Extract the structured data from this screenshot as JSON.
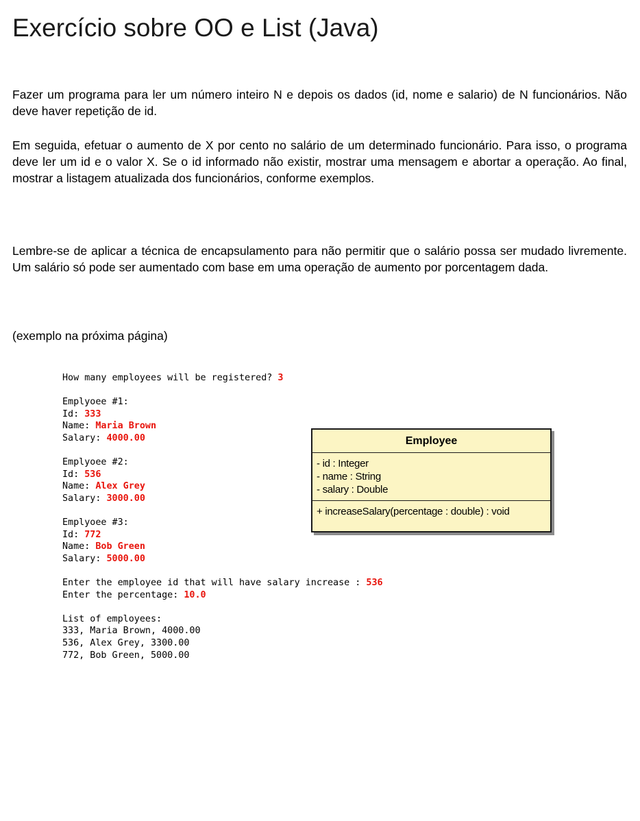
{
  "title": "Exercício sobre OO e List (Java)",
  "paragraphs": {
    "p1": "Fazer um programa para ler um número inteiro N e depois os dados (id, nome e salario) de N funcionários. Não deve haver repetição de id.",
    "p2": "Em seguida, efetuar o aumento de X por cento no salário de um determinado funcionário. Para isso, o programa deve ler um id e o valor X. Se o id informado não existir, mostrar uma mensagem e abortar a operação. Ao final, mostrar a listagem atualizada dos funcionários, conforme exemplos.",
    "p3": "Lembre-se de aplicar a técnica de encapsulamento para não permitir que o salário possa ser mudado livremente. Um salário só pode ser aumentado com base em uma operação de aumento por porcentagem dada.",
    "p4": "(exemplo na próxima página)"
  },
  "console": {
    "q_prompt": "How many employees will be registered? ",
    "q_value": "3",
    "employees": [
      {
        "header": "Emplyoee #1:",
        "id_label": "Id: ",
        "id": "333",
        "name_label": "Name: ",
        "name": "Maria Brown",
        "salary_label": "Salary: ",
        "salary": "4000.00"
      },
      {
        "header": "Emplyoee #2:",
        "id_label": "Id: ",
        "id": "536",
        "name_label": "Name: ",
        "name": "Alex Grey",
        "salary_label": "Salary: ",
        "salary": "3000.00"
      },
      {
        "header": "Emplyoee #3:",
        "id_label": "Id: ",
        "id": "772",
        "name_label": "Name: ",
        "name": "Bob Green",
        "salary_label": "Salary: ",
        "salary": "5000.00"
      }
    ],
    "increase_prompt": "Enter the employee id that will have salary increase : ",
    "increase_id": "536",
    "percent_prompt": "Enter the percentage: ",
    "percent_value": "10.0",
    "list_header": "List of employees:",
    "list": [
      "333, Maria Brown, 4000.00",
      "536, Alex Grey, 3300.00",
      "772, Bob Green, 5000.00"
    ]
  },
  "uml": {
    "class_name": "Employee",
    "attributes": [
      "- id : Integer",
      "- name : String",
      "- salary : Double"
    ],
    "operation": "+ increaseSalary(percentage : double) : void"
  },
  "colors": {
    "input_text": "#e8140c",
    "uml_fill": "#fcf5c4",
    "uml_shadow": "#8c8c8c"
  }
}
